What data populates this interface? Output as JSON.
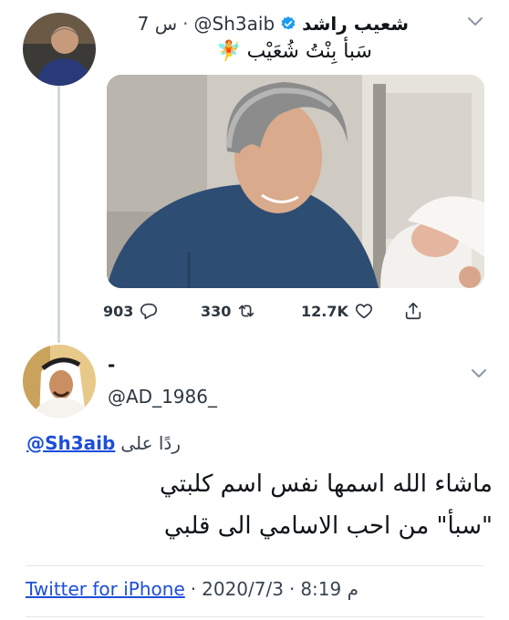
{
  "tweet": {
    "display_name": "شعيب راشد",
    "handle": "@Sh3aib",
    "separator": "·",
    "time": "7 س",
    "text": "سَبأ بِنْتُ شُعَيْب",
    "emoji": "🧚",
    "actions": {
      "replies": "903",
      "retweets": "330",
      "likes": "12.7K"
    }
  },
  "reply": {
    "display_name": "-",
    "handle": "@AD_1986_",
    "replying_to_label": "ردًا على",
    "replying_to_handle": "@Sh3aib",
    "text": "ماشاء الله اسمها نفس اسم كلبتي \"سبأ\" من احب الاسامي الى قلبي",
    "time": "8:19 م",
    "date": "2020/7/3",
    "dot": "·",
    "source": "Twitter for iPhone"
  },
  "colors": {
    "link": "#1d4ed8",
    "verified": "#1d9bf0",
    "muted": "#536471"
  }
}
